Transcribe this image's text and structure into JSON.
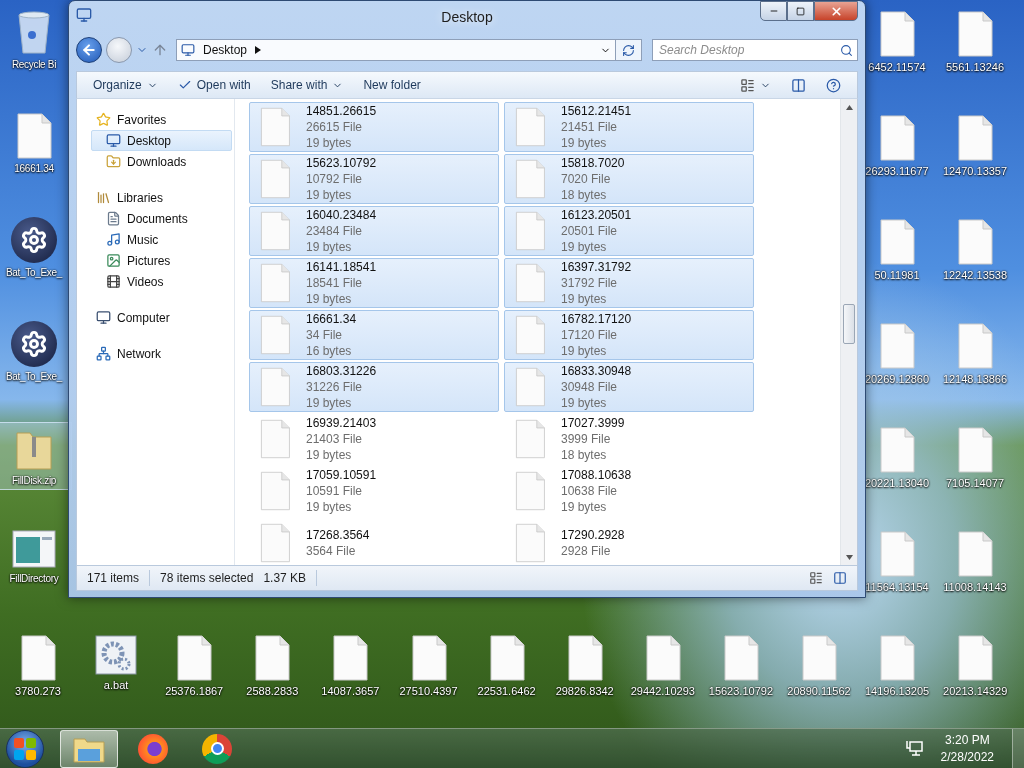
{
  "window": {
    "title": "Desktop",
    "address": [
      "Desktop"
    ],
    "search": {
      "placeholder": "Search Desktop"
    },
    "toolbar": [
      {
        "label": "Organize",
        "kind": "menu"
      },
      {
        "label": "Open with",
        "kind": "icon"
      },
      {
        "label": "Share with",
        "kind": "menu"
      },
      {
        "label": "New folder",
        "kind": "plain"
      }
    ],
    "nav": [
      {
        "label": "Favorites",
        "kind": "favorites",
        "selected": false,
        "children": [
          {
            "label": "Desktop",
            "kind": "desktop",
            "selected": true
          },
          {
            "label": "Downloads",
            "kind": "downloads",
            "selected": false
          }
        ]
      },
      {
        "label": "Libraries",
        "kind": "libraries",
        "selected": false,
        "children": [
          {
            "label": "Documents",
            "kind": "documents",
            "selected": false
          },
          {
            "label": "Music",
            "kind": "music",
            "selected": false
          },
          {
            "label": "Pictures",
            "kind": "pictures",
            "selected": false
          },
          {
            "label": "Videos",
            "kind": "videos",
            "selected": false
          }
        ]
      },
      {
        "label": "Computer",
        "kind": "computer",
        "selected": false
      },
      {
        "label": "Network",
        "kind": "network",
        "selected": false
      }
    ],
    "files": [
      {
        "name": "14851.26615",
        "type": "26615 File",
        "size": "19 bytes",
        "selected": true
      },
      {
        "name": "15612.21451",
        "type": "21451 File",
        "size": "19 bytes",
        "selected": true
      },
      {
        "name": "15623.10792",
        "type": "10792 File",
        "size": "19 bytes",
        "selected": true
      },
      {
        "name": "15818.7020",
        "type": "7020 File",
        "size": "18 bytes",
        "selected": true
      },
      {
        "name": "16040.23484",
        "type": "23484 File",
        "size": "19 bytes",
        "selected": true
      },
      {
        "name": "16123.20501",
        "type": "20501 File",
        "size": "19 bytes",
        "selected": true
      },
      {
        "name": "16141.18541",
        "type": "18541 File",
        "size": "19 bytes",
        "selected": true
      },
      {
        "name": "16397.31792",
        "type": "31792 File",
        "size": "19 bytes",
        "selected": true
      },
      {
        "name": "16661.34",
        "type": "34 File",
        "size": "16 bytes",
        "selected": true
      },
      {
        "name": "16782.17120",
        "type": "17120 File",
        "size": "19 bytes",
        "selected": true
      },
      {
        "name": "16803.31226",
        "type": "31226 File",
        "size": "19 bytes",
        "selected": true
      },
      {
        "name": "16833.30948",
        "type": "30948 File",
        "size": "19 bytes",
        "selected": true
      },
      {
        "name": "16939.21403",
        "type": "21403 File",
        "size": "19 bytes",
        "selected": false
      },
      {
        "name": "17027.3999",
        "type": "3999 File",
        "size": "18 bytes",
        "selected": false
      },
      {
        "name": "17059.10591",
        "type": "10591 File",
        "size": "19 bytes",
        "selected": false
      },
      {
        "name": "17088.10638",
        "type": "10638 File",
        "size": "19 bytes",
        "selected": false
      },
      {
        "name": "17268.3564",
        "type": "3564 File",
        "selected": false
      },
      {
        "name": "17290.2928",
        "type": "2928 File",
        "selected": false
      }
    ],
    "status": {
      "items": "171 items",
      "selected": "78 items selected",
      "size": "1.37 KB"
    }
  },
  "desktop": {
    "left_column": [
      {
        "label": "Recycle Bi",
        "kind": "recycle",
        "selected": false
      },
      {
        "label": "16661.34",
        "kind": "file",
        "selected": false
      },
      {
        "label": "Bat_To_Exe_",
        "kind": "gear",
        "selected": false
      },
      {
        "label": "Bat_To_Exe_",
        "kind": "gear",
        "selected": false
      },
      {
        "label": "FillDisk.zip",
        "kind": "zip",
        "selected": true
      },
      {
        "label": "FillDirectory",
        "kind": "app",
        "selected": false
      }
    ],
    "right_column_1": [
      {
        "label": "6452.11574",
        "kind": "file",
        "selected": false
      },
      {
        "label": "26293.11677",
        "kind": "file",
        "selected": false
      },
      {
        "label": "50.11981",
        "kind": "file",
        "selected": false
      },
      {
        "label": "20269.12860",
        "kind": "file",
        "selected": false
      },
      {
        "label": "20221.13040",
        "kind": "file",
        "selected": false
      },
      {
        "label": "11564.13154",
        "kind": "file",
        "selected": false
      }
    ],
    "right_column_2": [
      {
        "label": "5561.13246",
        "kind": "file",
        "selected": false
      },
      {
        "label": "12470.13357",
        "kind": "file",
        "selected": false
      },
      {
        "label": "12242.13538",
        "kind": "file",
        "selected": false
      },
      {
        "label": "12148.13866",
        "kind": "file",
        "selected": false
      },
      {
        "label": "7105.14077",
        "kind": "file",
        "selected": false
      },
      {
        "label": "11008.14143",
        "kind": "file",
        "selected": false
      }
    ],
    "bottom_row": [
      {
        "label": "3780.273",
        "kind": "file",
        "selected": false
      },
      {
        "label": "a.bat",
        "kind": "batch",
        "selected": false
      },
      {
        "label": "25376.1867",
        "kind": "file",
        "selected": false
      },
      {
        "label": "2588.2833",
        "kind": "file",
        "selected": false
      },
      {
        "label": "14087.3657",
        "kind": "file",
        "selected": false
      },
      {
        "label": "27510.4397",
        "kind": "file",
        "selected": false
      },
      {
        "label": "22531.6462",
        "kind": "file",
        "selected": false
      },
      {
        "label": "29826.8342",
        "kind": "file",
        "selected": false
      },
      {
        "label": "29442.10293",
        "kind": "file",
        "selected": false
      },
      {
        "label": "15623.10792",
        "kind": "file",
        "selected": false
      },
      {
        "label": "20890.11562",
        "kind": "file",
        "selected": false
      },
      {
        "label": "14196.13205",
        "kind": "file",
        "selected": false
      },
      {
        "label": "20213.14329",
        "kind": "file",
        "selected": false
      }
    ]
  },
  "taskbar": {
    "apps": [
      {
        "kind": "explorer",
        "selected": true
      },
      {
        "kind": "firefox",
        "selected": false
      },
      {
        "kind": "chrome",
        "selected": false
      }
    ],
    "clock": {
      "time": "3:20 PM",
      "date": "2/28/2022"
    }
  }
}
